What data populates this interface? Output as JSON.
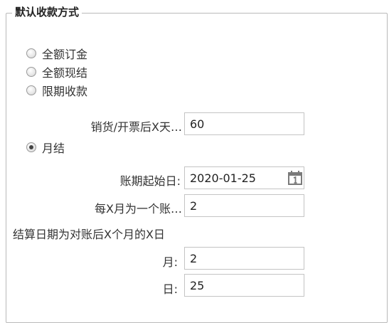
{
  "legend": "默认收款方式",
  "options": [
    {
      "label": "全额订金",
      "checked": false
    },
    {
      "label": "全额现结",
      "checked": false
    },
    {
      "label": "限期收款",
      "checked": false
    },
    {
      "label": "月结",
      "checked": true
    }
  ],
  "fields": {
    "days_after_label": "销货/开票后X天…",
    "days_after_value": "60",
    "period_start_label": "账期起始日:",
    "period_start_value": "2020-01-25",
    "months_per_period_label": "每X月为一个账…",
    "months_per_period_value": "2",
    "settlement_text": "结算日期为对账后X个月的X日",
    "month_label": "月:",
    "month_value": "2",
    "day_label": "日:",
    "day_value": "25"
  },
  "icons": {
    "calendar": "calendar-icon"
  }
}
